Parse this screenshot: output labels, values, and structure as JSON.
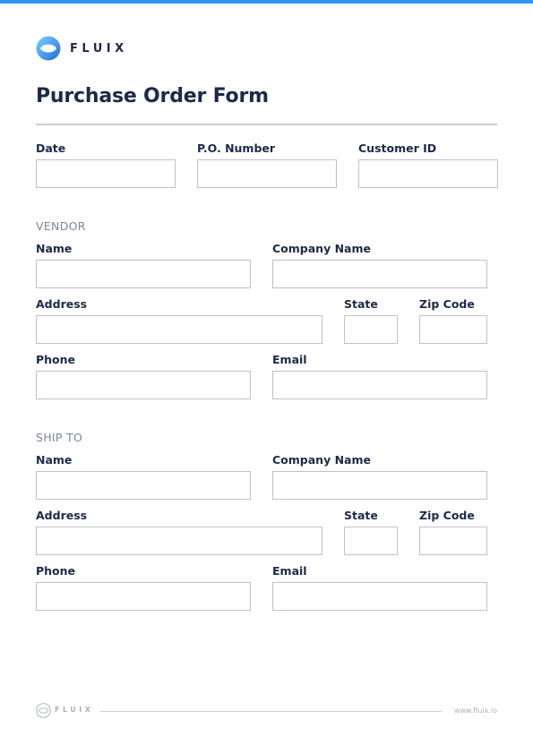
{
  "brand": {
    "name": "FLUIX",
    "footer_name": "FLUIX",
    "url": "www.fluix.io",
    "accent_color": "#2f96ee"
  },
  "form": {
    "title": "Purchase Order Form",
    "header_fields": {
      "date_label": "Date",
      "po_number_label": "P.O. Number",
      "customer_id_label": "Customer ID"
    }
  },
  "vendor": {
    "heading": "VENDOR",
    "name_label": "Name",
    "company_label": "Company Name",
    "address_label": "Address",
    "state_label": "State",
    "zip_label": "Zip Code",
    "phone_label": "Phone",
    "email_label": "Email"
  },
  "ship_to": {
    "heading": "SHIP TO",
    "name_label": "Name",
    "company_label": "Company Name",
    "address_label": "Address",
    "state_label": "State",
    "zip_label": "Zip Code",
    "phone_label": "Phone",
    "email_label": "Email"
  },
  "icons": {
    "logo": "fluix-logo-icon",
    "footer_logo": "fluix-footer-logo-icon"
  }
}
